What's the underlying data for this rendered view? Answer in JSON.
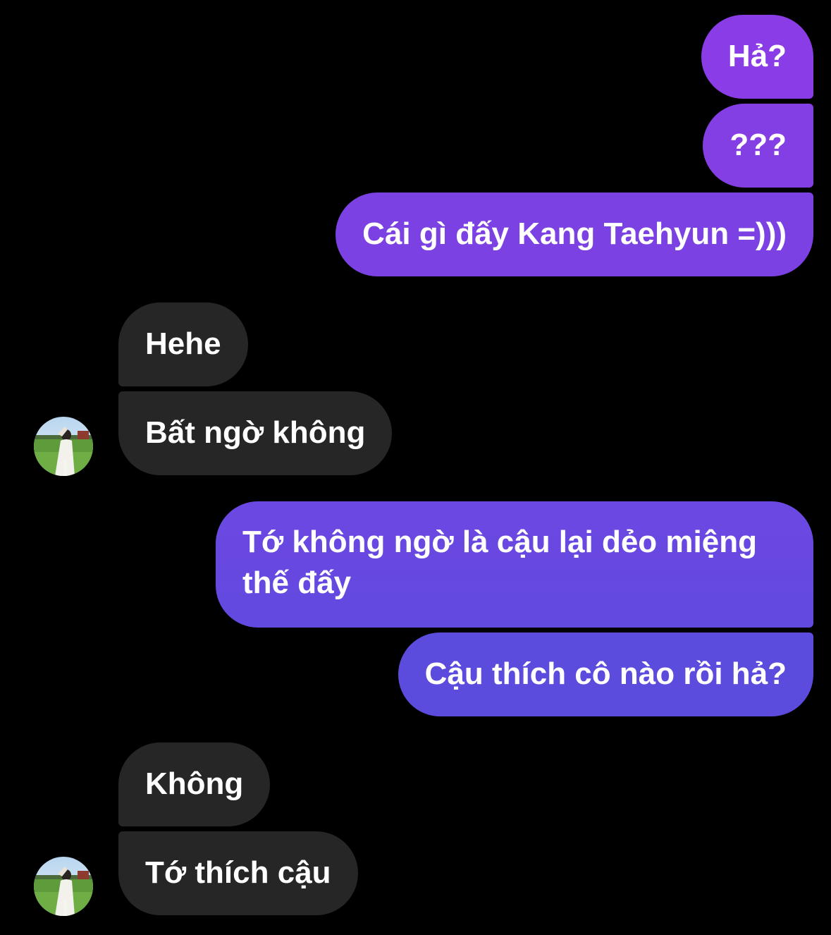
{
  "conversation": {
    "messages": [
      {
        "sender": "me",
        "text": "Hả?"
      },
      {
        "sender": "me",
        "text": "???"
      },
      {
        "sender": "me",
        "text": "Cái gì đấy Kang Taehyun =)))"
      },
      {
        "sender": "contact",
        "text": "Hehe"
      },
      {
        "sender": "contact",
        "text": "Bất ngờ không"
      },
      {
        "sender": "me",
        "text": "Tớ không ngờ là cậu lại dẻo miệng thế đấy"
      },
      {
        "sender": "me",
        "text": "Cậu thích cô nào rồi hả?"
      },
      {
        "sender": "contact",
        "text": "Không"
      },
      {
        "sender": "contact",
        "text": "Tớ thích cậu"
      }
    ]
  },
  "colors": {
    "background": "#000000",
    "sent_bubble_top": "#8a3de6",
    "sent_bubble_bottom": "#5c4cdd",
    "received_bubble": "#262626",
    "text": "#ffffff"
  },
  "icons": {
    "contact_avatar": "contact-avatar-photo"
  }
}
